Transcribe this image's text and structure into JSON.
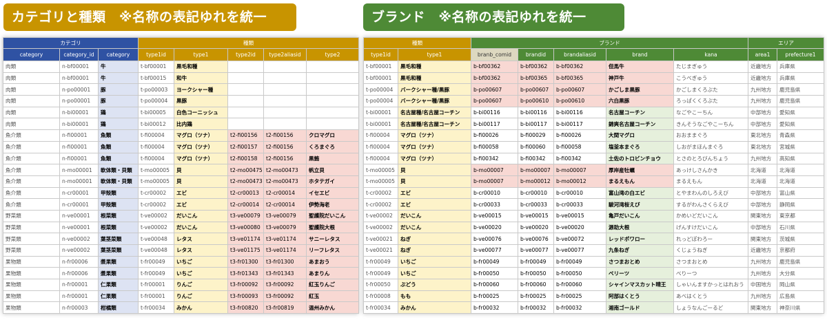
{
  "left": {
    "banner": "カテゴリと種類　※名称の表記ゆれを統一",
    "group_headers": {
      "category": "カテゴリ",
      "type": "種類"
    },
    "columns": [
      "category",
      "category_id",
      "category",
      "type1id",
      "type1",
      "type2id",
      "type2aliasid",
      "type2"
    ],
    "rows": [
      [
        "肉類",
        "n-bf00001",
        "牛",
        "t-bf00001",
        "黒毛和種",
        "",
        "",
        ""
      ],
      [
        "肉類",
        "n-bf00001",
        "牛",
        "t-bf00015",
        "和牛",
        "",
        "",
        ""
      ],
      [
        "肉類",
        "n-po00001",
        "豚",
        "t-po00003",
        "ヨークシャー種",
        "",
        "",
        ""
      ],
      [
        "肉類",
        "n-po00001",
        "豚",
        "t-po00004",
        "黒豚",
        "",
        "",
        ""
      ],
      [
        "肉類",
        "n-bi00001",
        "鶏",
        "t-bi00005",
        "白色コーニッシュ",
        "",
        "",
        ""
      ],
      [
        "肉類",
        "n-bi00001",
        "鶏",
        "t-bi00012",
        "比内鶏",
        "",
        "",
        ""
      ],
      [
        "魚介類",
        "n-fi00001",
        "魚類",
        "t-fi00004",
        "マグロ（ツナ）",
        "t2-fi00156",
        "t2-fi00156",
        "クロマグロ"
      ],
      [
        "魚介類",
        "n-fi00001",
        "魚類",
        "t-fi00004",
        "マグロ（ツナ）",
        "t2-fi00157",
        "t2-fi00156",
        "くろまぐろ"
      ],
      [
        "魚介類",
        "n-fi00001",
        "魚類",
        "t-fi00004",
        "マグロ（ツナ）",
        "t2-fi00158",
        "t2-fi00156",
        "黒鮪"
      ],
      [
        "魚介類",
        "n-mo00001",
        "軟体類・貝類",
        "t-mo00005",
        "貝",
        "t2-mo00475",
        "t2-mo00473",
        "帆立貝"
      ],
      [
        "魚介類",
        "n-mo00001",
        "軟体類・貝類",
        "t-mo00005",
        "貝",
        "t2-mo00473",
        "t2-mo00473",
        "ホタテガイ"
      ],
      [
        "魚介類",
        "n-cr00001",
        "甲殻類",
        "t-cr00002",
        "エビ",
        "t2-cr00013",
        "t2-cr00014",
        "イセエビ"
      ],
      [
        "魚介類",
        "n-cr00001",
        "甲殻類",
        "t-cr00002",
        "エビ",
        "t2-cr00014",
        "t2-cr00014",
        "伊勢海老"
      ],
      [
        "野菜類",
        "n-ve00001",
        "根菜類",
        "t-ve00002",
        "だいこん",
        "t3-ve00079",
        "t3-ve00079",
        "聖護院だいこん"
      ],
      [
        "野菜類",
        "n-ve00001",
        "根菜類",
        "t-ve00002",
        "だいこん",
        "t3-ve00080",
        "t3-ve00079",
        "聖護院大根"
      ],
      [
        "野菜類",
        "n-ve00002",
        "葉茎菜類",
        "t-ve00048",
        "レタス",
        "t3-ve01174",
        "t3-ve01174",
        "サニーレタス"
      ],
      [
        "野菜類",
        "n-ve00002",
        "葉茎菜類",
        "t-ve00048",
        "レタス",
        "t3-ve01175",
        "t3-ve01174",
        "リーフレタス"
      ],
      [
        "果物類",
        "n-fr00006",
        "漿果類",
        "t-fr00049",
        "いちご",
        "t3-fr01300",
        "t3-fr01300",
        "あまおう"
      ],
      [
        "果物類",
        "n-fr00006",
        "漿果類",
        "t-fr00049",
        "いちご",
        "t3-fr01343",
        "t3-fr01343",
        "あまりん"
      ],
      [
        "果物類",
        "n-fr00001",
        "仁果類",
        "t-fr00001",
        "りんご",
        "t3-fr00092",
        "t3-fr00092",
        "紅玉りんご"
      ],
      [
        "果物類",
        "n-fr00001",
        "仁果類",
        "t-fr00001",
        "りんご",
        "t3-fr00093",
        "t3-fr00092",
        "紅玉"
      ],
      [
        "果物類",
        "n-fr00003",
        "柑橘類",
        "t-fr00034",
        "みかん",
        "t3-fr00820",
        "t3-fr00819",
        "温州みかん"
      ]
    ]
  },
  "right": {
    "banner": "ブランド　※名称の表記ゆれを統一",
    "group_headers": {
      "type": "種類",
      "brand": "ブランド",
      "area": "エリア"
    },
    "columns": [
      "type1id",
      "type1",
      "branb_comid",
      "brandid",
      "brandaliasid",
      "brand",
      "kana",
      "area1",
      "prefecture1"
    ],
    "rows": [
      [
        "t-bf00001",
        "黒毛和種",
        "b-bf00362",
        "b-bf00362",
        "b-bf00362",
        "但馬牛",
        "たじまぎゅう",
        "近畿地方",
        "兵庫県"
      ],
      [
        "t-bf00001",
        "黒毛和種",
        "b-bf00362",
        "b-bf00365",
        "b-bf00365",
        "神戸牛",
        "こうべぎゅう",
        "近畿地方",
        "兵庫県"
      ],
      [
        "t-po00004",
        "バークシャー種/黒豚",
        "b-po00607",
        "b-po00607",
        "b-po00607",
        "かごしま黒豚",
        "かごしまくろぶた",
        "九州地方",
        "鹿児島県"
      ],
      [
        "t-po00004",
        "バークシャー種/黒豚",
        "b-po00607",
        "b-po00610",
        "b-po00610",
        "六白黒豚",
        "ろっぱくくろぶた",
        "九州地方",
        "鹿児島県"
      ],
      [
        "t-bi00001",
        "名古屋種/名古屋コーチン",
        "b-bi00116",
        "b-bi00116",
        "b-bi00116",
        "名古屋コーチン",
        "なごやこーちん",
        "中部地方",
        "愛知県"
      ],
      [
        "t-bi00001",
        "名古屋種/名古屋コーチン",
        "b-bi00117",
        "b-bi00117",
        "b-bi00117",
        "錦爽名古屋コーチン",
        "きんそうなごやこーちん",
        "中部地方",
        "愛知県"
      ],
      [
        "t-fi00004",
        "マグロ（ツナ）",
        "b-fi00026",
        "b-fi00029",
        "b-fi00026",
        "大間マグロ",
        "おおままぐろ",
        "東北地方",
        "青森県"
      ],
      [
        "t-fi00004",
        "マグロ（ツナ）",
        "b-fi00058",
        "b-fi00060",
        "b-fi00058",
        "塩釜本まぐろ",
        "しおがまほんまぐろ",
        "東北地方",
        "宮城県"
      ],
      [
        "t-fi00004",
        "マグロ（ツナ）",
        "b-fi00342",
        "b-fi00342",
        "b-fi00342",
        "土佐のトロビンチョウ",
        "とさのとろびんちょう",
        "九州地方",
        "高知県"
      ],
      [
        "t-mo00005",
        "貝",
        "b-mo00007",
        "b-mo00007",
        "b-mo00007",
        "厚岸産牡蠣",
        "あっけしさんかき",
        "北海道",
        "北海道"
      ],
      [
        "t-mo00005",
        "貝",
        "b-mo00007",
        "b-mo00012",
        "b-mo00012",
        "まるえもん",
        "まるえもん",
        "北海道",
        "北海道"
      ],
      [
        "t-cr00002",
        "エビ",
        "b-cr00010",
        "b-cr00010",
        "b-cr00010",
        "富山湾の白エビ",
        "とやまわんのしろえび",
        "中部地方",
        "富山県"
      ],
      [
        "t-cr00002",
        "エビ",
        "b-cr00033",
        "b-cr00033",
        "b-cr00033",
        "駿河湾桜えび",
        "するがわんさくらえび",
        "中部地方",
        "静岡県"
      ],
      [
        "t-ve00002",
        "だいこん",
        "b-ve00015",
        "b-ve00015",
        "b-ve00015",
        "亀戸だいこん",
        "かめいどだいこん",
        "関東地方",
        "東京都"
      ],
      [
        "t-ve00002",
        "だいこん",
        "b-ve00020",
        "b-ve00020",
        "b-ve00020",
        "源助大根",
        "げんすけだいこん",
        "中部地方",
        "石川県"
      ],
      [
        "t-ve00021",
        "ねぎ",
        "b-ve00076",
        "b-ve00076",
        "b-ve00072",
        "レッドポワロー",
        "れっどぽわろー",
        "関東地方",
        "茨城県"
      ],
      [
        "t-ve00021",
        "ねぎ",
        "b-ve00077",
        "b-ve00077",
        "b-ve00077",
        "九条ねぎ",
        "くじょうねぎ",
        "近畿地方",
        "京都府"
      ],
      [
        "t-fr00049",
        "いちご",
        "b-fr00049",
        "b-fr00049",
        "b-fr00049",
        "さつまおとめ",
        "さつまおとめ",
        "九州地方",
        "鹿児島県"
      ],
      [
        "t-fr00049",
        "いちご",
        "b-fr00050",
        "b-fr00050",
        "b-fr00050",
        "ベリーツ",
        "べりーつ",
        "九州地方",
        "大分県"
      ],
      [
        "t-fr00050",
        "ぶどう",
        "b-fr00060",
        "b-fr00060",
        "b-fr00060",
        "シャインマスカット晴王",
        "しゃいんますかっとはれおう",
        "中国地方",
        "岡山県"
      ],
      [
        "t-fr00008",
        "もも",
        "b-fr00025",
        "b-fr00025",
        "b-fr00025",
        "阿部はくとう",
        "あべはくとう",
        "九州地方",
        "広島県"
      ],
      [
        "t-fr00034",
        "みかん",
        "b-fr00032",
        "b-fr00032",
        "b-fr00032",
        "湘南ゴールド",
        "しょうなんごーるど",
        "関東地方",
        "神奈川県"
      ]
    ]
  },
  "colors": {
    "left_banner": "#c89400",
    "right_banner": "#4e8a36",
    "category_header": "#2f52a3"
  }
}
